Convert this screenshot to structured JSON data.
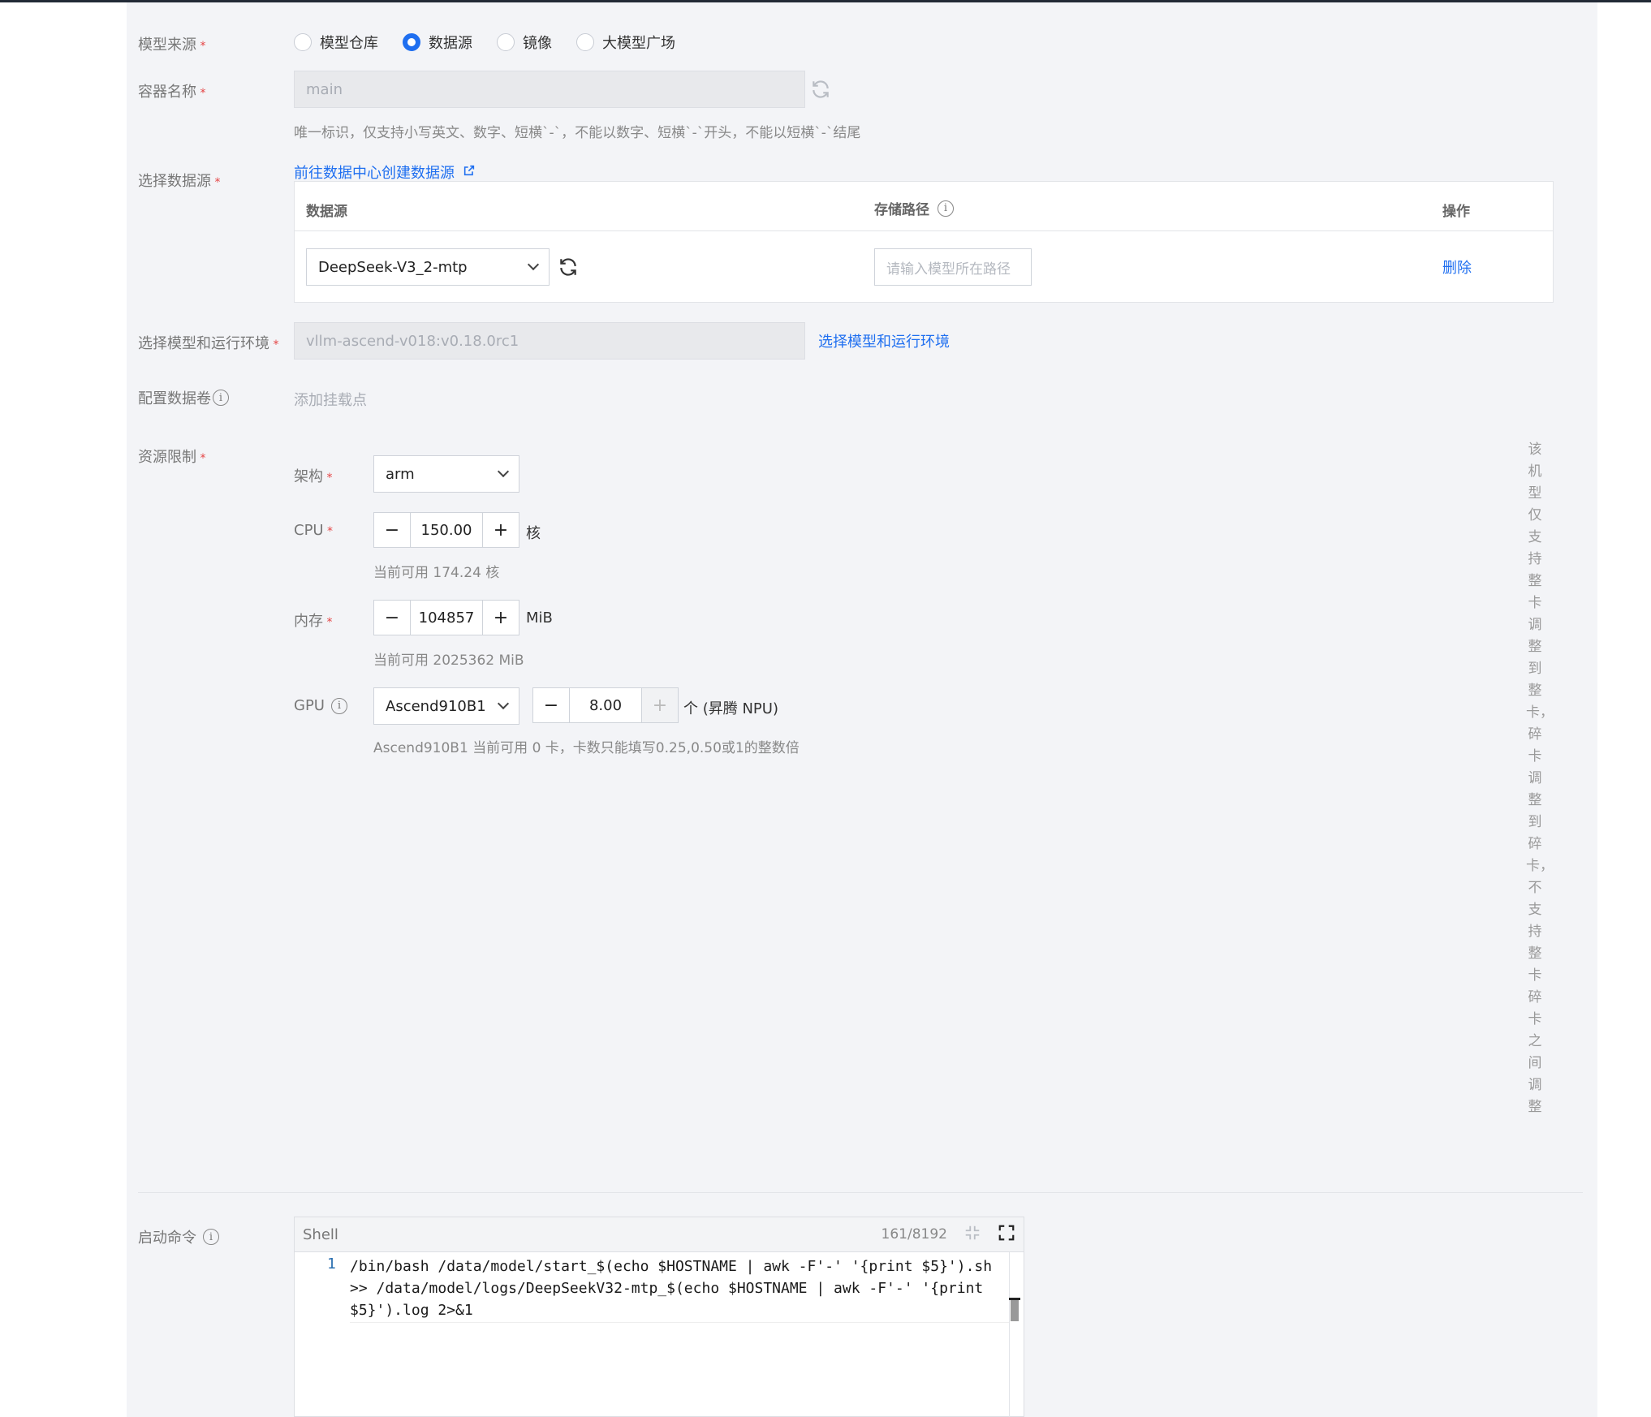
{
  "form": {
    "model_source": {
      "label": "模型来源",
      "options": [
        "模型仓库",
        "数据源",
        "镜像",
        "大模型广场"
      ],
      "selected": "数据源"
    },
    "container_name": {
      "label": "容器名称",
      "value": "main",
      "hint": "唯一标识，仅支持小写英文、数字、短横`-`，不能以数字、短横`-`开头，不能以短横`-`结尾"
    },
    "datasource": {
      "label": "选择数据源",
      "create_link": "前往数据中心创建数据源",
      "columns": [
        "数据源",
        "存储路径",
        "操作"
      ],
      "row": {
        "source": "DeepSeek-V3_2-mtp",
        "path_placeholder": "请输入模型所在路径",
        "action": "删除"
      }
    },
    "runtime": {
      "label": "选择模型和运行环境",
      "value": "vllm-ascend-v018:v0.18.0rc1",
      "link": "选择模型和运行环境"
    },
    "volume": {
      "label": "配置数据卷",
      "add_mount": "添加挂载点"
    },
    "resources": {
      "label": "资源限制",
      "arch": {
        "label": "架构",
        "value": "arm"
      },
      "cpu": {
        "label": "CPU",
        "value": "150.00",
        "unit": "核",
        "hint": "当前可用 174.24 核"
      },
      "memory": {
        "label": "内存",
        "value": "104857",
        "unit": "MiB",
        "hint": "当前可用 2025362 MiB"
      },
      "gpu": {
        "label": "GPU",
        "model": "Ascend910B1",
        "value": "8.00",
        "unit": "个 (昇腾 NPU)",
        "hint": "Ascend910B1 当前可用 0 卡，卡数只能填写0.25,0.50或1的整数倍"
      },
      "side_note": "该机型仅支持整卡调整到整卡，碎卡调整到碎卡，不支持整卡碎卡之间调整"
    },
    "startup": {
      "label": "启动命令",
      "lang": "Shell",
      "counter": "161/8192",
      "line_number": "1",
      "code_lines": [
        "/bin/bash /data/model/start_$(echo $HOSTNAME | awk -F'-' '{print $5}').sh",
        ">> /data/model/logs/DeepSeekV32-mtp_$(echo $HOSTNAME | awk -F'-' '{print",
        "$5}').log 2>&1"
      ]
    }
  },
  "colors": {
    "accent": "#1f6ff0",
    "required": "#e54545",
    "panel_bg": "#f3f4f7"
  }
}
